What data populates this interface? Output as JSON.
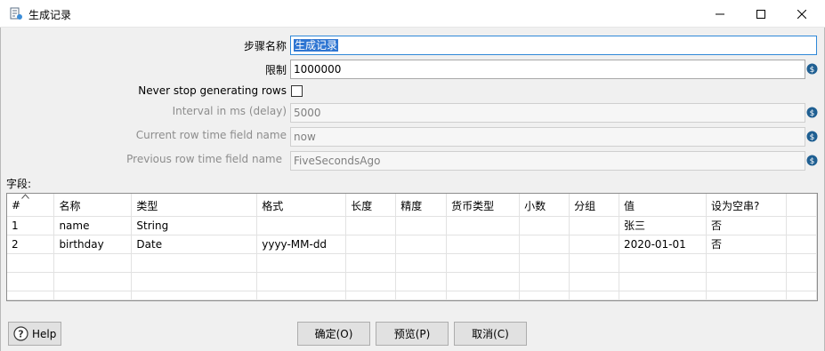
{
  "window": {
    "title": "生成记录",
    "icons": {
      "app": "dialog-form-icon",
      "minimize": "minimize-icon",
      "maximize": "maximize-icon",
      "close": "close-icon"
    }
  },
  "form": {
    "step_name_label": "步骤名称",
    "step_name_value": "生成记录",
    "limit_label": "限制",
    "limit_value": "1000000",
    "never_stop_label": "Never stop generating rows",
    "never_stop_checked": false,
    "interval_label": "Interval in ms (delay)",
    "interval_value": "5000",
    "current_time_label": "Current row time field name",
    "current_time_value": "now",
    "previous_time_label": "Previous row time field name",
    "previous_time_value": "FiveSecondsAgo",
    "variable_icon": "variable-dollar-icon"
  },
  "fields": {
    "label": "字段:",
    "columns": [
      "#",
      "名称",
      "类型",
      "格式",
      "长度",
      "精度",
      "货币类型",
      "小数",
      "分组",
      "值",
      "设为空串?"
    ],
    "rows": [
      [
        "1",
        "name",
        "String",
        "",
        "",
        "",
        "",
        "",
        "",
        "张三",
        "否"
      ],
      [
        "2",
        "birthday",
        "Date",
        "yyyy-MM-dd",
        "",
        "",
        "",
        "",
        "",
        "2020-01-01",
        "否"
      ]
    ]
  },
  "buttons": {
    "help": "Help",
    "ok": "确定(O)",
    "preview": "预览(P)",
    "cancel": "取消(C)"
  },
  "colors": {
    "accent": "#2f76d2",
    "focus_border": "#2f88d8",
    "variable_icon": "#1f5f92"
  }
}
